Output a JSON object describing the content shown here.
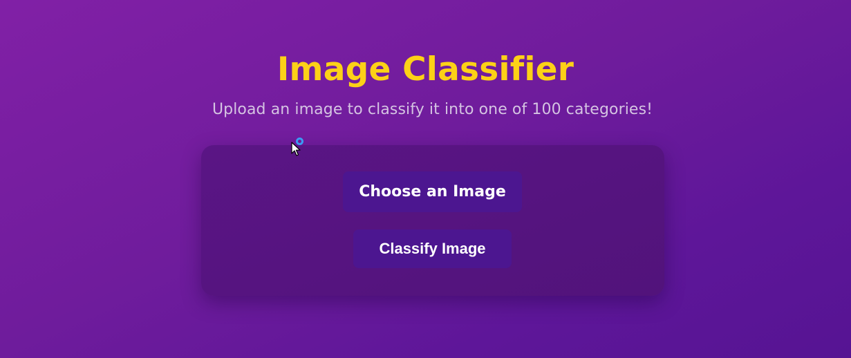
{
  "header": {
    "title": "Image Classifier",
    "subtitle": "Upload an image to classify it into one of 100 categories!"
  },
  "upload_card": {
    "choose_button_label": "Choose an Image",
    "classify_button_label": "Classify Image"
  },
  "cursor": {
    "icon": "arrow-pointer-icon",
    "busy_indicator_icon": "loading-ring-icon"
  },
  "colors": {
    "background_start": "#8120a6",
    "background_end": "#561493",
    "title": "#fdd117",
    "subtitle": "#d5c4e2",
    "card": "#55147f",
    "button": "#4c1690",
    "button_text": "#ffffff",
    "busy_ring": "#3b9bf3"
  }
}
